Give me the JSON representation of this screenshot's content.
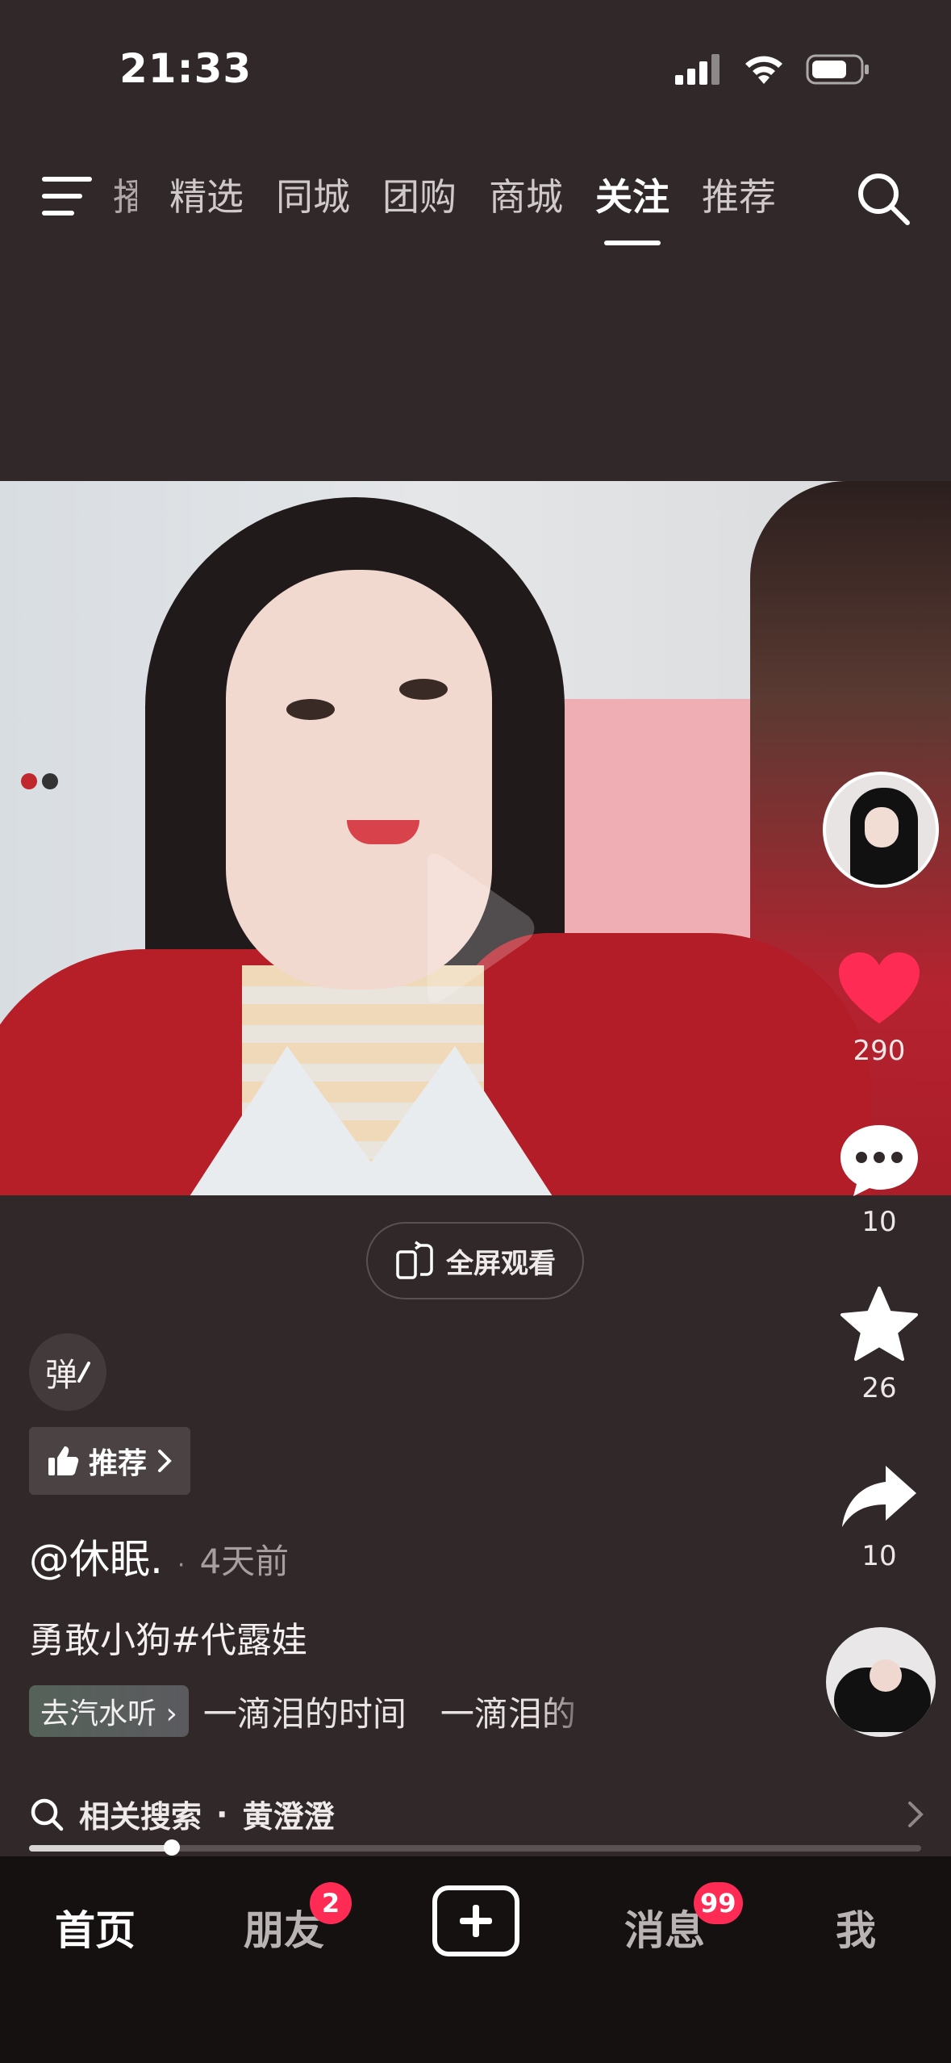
{
  "status_bar": {
    "time": "21:33"
  },
  "top_nav": {
    "tabs": [
      {
        "label": "播",
        "active": false,
        "partial": true
      },
      {
        "label": "精选",
        "active": false
      },
      {
        "label": "同城",
        "active": false
      },
      {
        "label": "团购",
        "active": false
      },
      {
        "label": "商城",
        "active": false
      },
      {
        "label": "关注",
        "active": true
      },
      {
        "label": "推荐",
        "active": false
      }
    ]
  },
  "actions": {
    "likes": "290",
    "comments": "10",
    "favorites": "26",
    "shares": "10"
  },
  "fullscreen": {
    "label": "全屏观看"
  },
  "danmu": {
    "label": "弹"
  },
  "recommend": {
    "label": "推荐"
  },
  "post": {
    "author": "@休眠.",
    "separator": "·",
    "time_ago": "4天前",
    "caption": "勇敢小狗#代露娃",
    "music_tag": "去汽水听",
    "music_text": "一滴泪的时间　一滴泪的"
  },
  "related_search": {
    "label": "相关搜索",
    "separator": "·",
    "query": "黄澄澄"
  },
  "progress": {
    "fraction": 0.16
  },
  "bottom_tabs": {
    "home": "首页",
    "friends": "朋友",
    "friends_badge": "2",
    "messages": "消息",
    "messages_badge": "99",
    "me": "我"
  },
  "colors": {
    "background": "#312829",
    "like_red": "#fe2c55",
    "tabbar": "#151111"
  }
}
